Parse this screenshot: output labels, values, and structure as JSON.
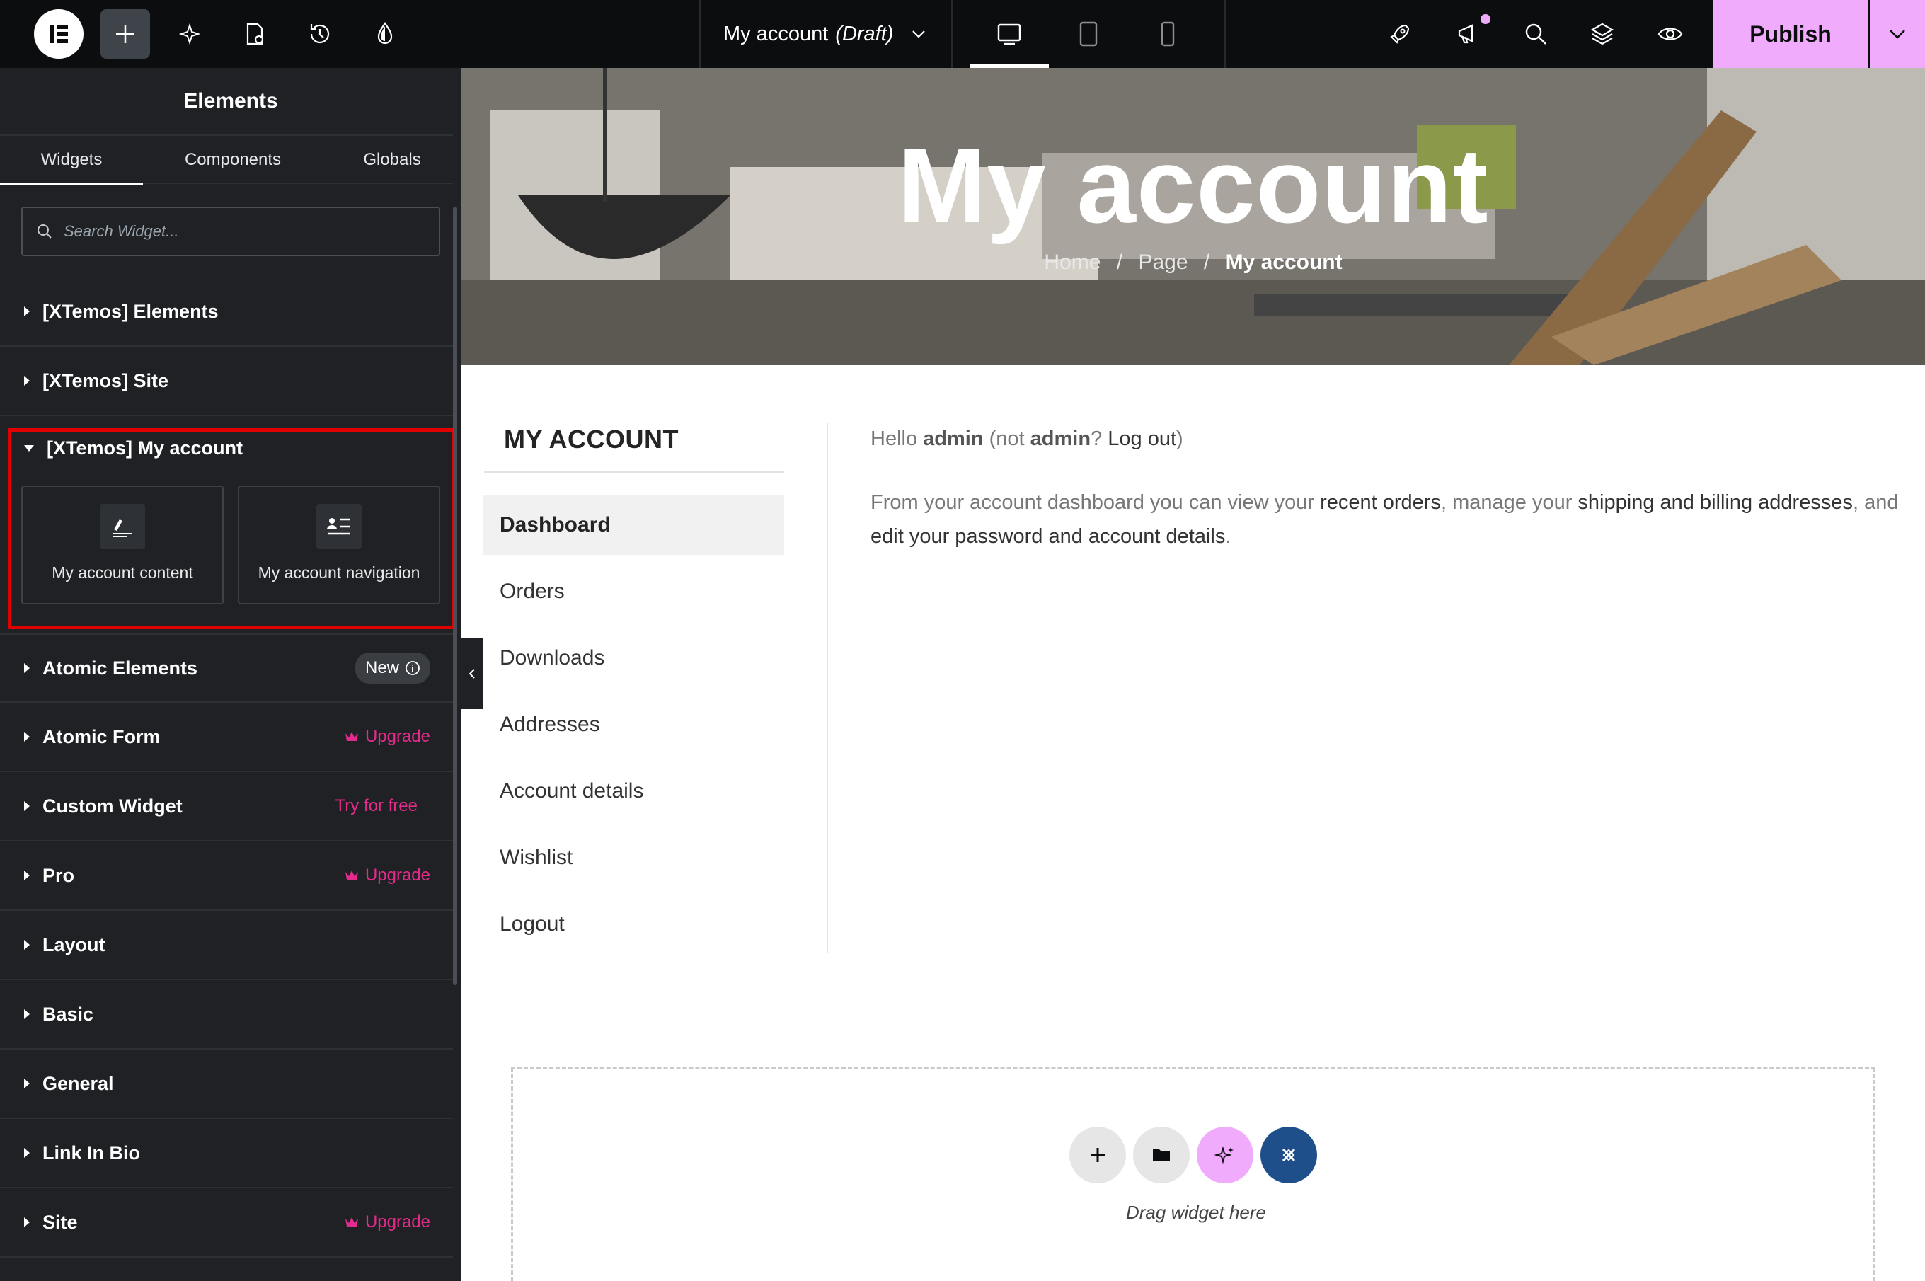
{
  "topbar": {
    "doc_title": "My account",
    "doc_status": "(Draft)",
    "publish_label": "Publish",
    "icons": [
      "elementor-logo-icon",
      "add-icon",
      "ai-sparkle-icon",
      "page-settings-icon",
      "history-icon",
      "theme-style-icon",
      "rocket-icon",
      "megaphone-icon",
      "search-icon",
      "layers-icon",
      "eye-icon",
      "chevron-down-icon"
    ],
    "devices": [
      "desktop-icon",
      "tablet-icon",
      "mobile-icon"
    ]
  },
  "panel": {
    "title": "Elements",
    "tabs": [
      {
        "label": "Widgets"
      },
      {
        "label": "Components"
      },
      {
        "label": "Globals"
      }
    ],
    "search_placeholder": "Search Widget...",
    "categories": [
      {
        "label": "[XTemos] Elements"
      },
      {
        "label": "[XTemos] Site"
      },
      {
        "label": "[XTemos] My account"
      },
      {
        "label": "Atomic Elements",
        "tag": "New"
      },
      {
        "label": "Atomic Form",
        "tag": "Upgrade"
      },
      {
        "label": "Custom Widget",
        "tag": "Try for free"
      },
      {
        "label": "Pro",
        "tag": "Upgrade"
      },
      {
        "label": "Layout"
      },
      {
        "label": "Basic"
      },
      {
        "label": "General"
      },
      {
        "label": "Link In Bio"
      },
      {
        "label": "Site",
        "tag": "Upgrade"
      }
    ],
    "widgets": [
      {
        "label": "My account content"
      },
      {
        "label": "My account navigation"
      }
    ]
  },
  "hero": {
    "title": "My account",
    "breadcrumbs": [
      "Home",
      "Page",
      "My account"
    ]
  },
  "account": {
    "title": "MY ACCOUNT",
    "nav": [
      "Dashboard",
      "Orders",
      "Downloads",
      "Addresses",
      "Account details",
      "Wishlist",
      "Logout"
    ],
    "hello_prefix": "Hello ",
    "hello_user": "admin",
    "hello_not": " (not ",
    "hello_user2": "admin",
    "hello_q": "? ",
    "hello_logout": "Log out",
    "hello_close": ")",
    "intro_1": "From your account dashboard you can view your ",
    "intro_link1": "recent orders",
    "intro_2": ", manage your ",
    "intro_link2": "shipping and billing addresses",
    "intro_3": ", and ",
    "intro_link3": "edit your password and account details",
    "intro_4": "."
  },
  "dropzone": {
    "text": "Drag widget here"
  },
  "colors": {
    "accent": "#f0abfc",
    "upgrade": "#e22b8a",
    "highlight": "#e00000",
    "panel_bg": "#1f2124",
    "topbar_bg": "#0c0d0e",
    "template_btn": "#1e4f8a"
  }
}
